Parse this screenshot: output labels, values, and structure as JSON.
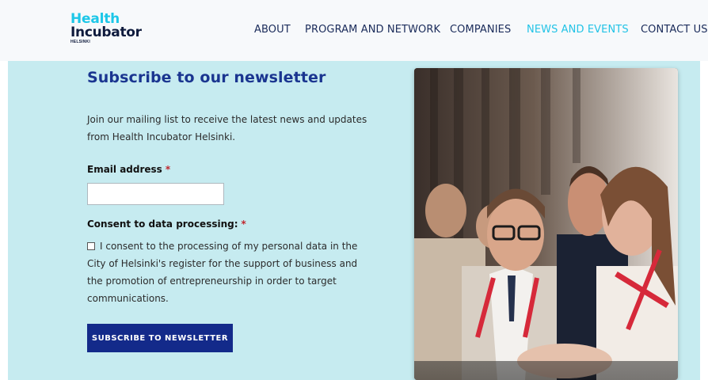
{
  "header": {
    "logo": {
      "line1": "Health",
      "line2": "Incubator",
      "line3": "HELSINKI"
    },
    "nav": [
      {
        "label": "ABOUT",
        "active": false
      },
      {
        "label": "PROGRAM AND NETWORK",
        "active": false
      },
      {
        "label": "COMPANIES",
        "active": false
      },
      {
        "label": "NEWS AND EVENTS",
        "active": true
      },
      {
        "label": "CONTACT US",
        "active": false
      }
    ]
  },
  "form": {
    "title": "Subscribe to our newsletter",
    "intro": "Join our mailing list to receive the latest news and updates from Health Incubator Helsinki.",
    "email_label": "Email address",
    "email_value": "",
    "consent_label": "Consent to data processing:",
    "required_marker": "*",
    "consent_text": "I consent to the processing of my personal data in the City of Helsinki's register for the support of business and the promotion of entrepreneurship in order to target communications.",
    "consent_checked": false,
    "submit_label": "SUBSCRIBE TO NEWSLETTER"
  },
  "colors": {
    "brand_cyan": "#22c3e6",
    "brand_navy": "#132a8a",
    "band_background": "#c6ebf0",
    "title_blue": "#1a3590",
    "required_red": "#c0262d"
  },
  "image": {
    "subject": "conference-audience-photo"
  }
}
